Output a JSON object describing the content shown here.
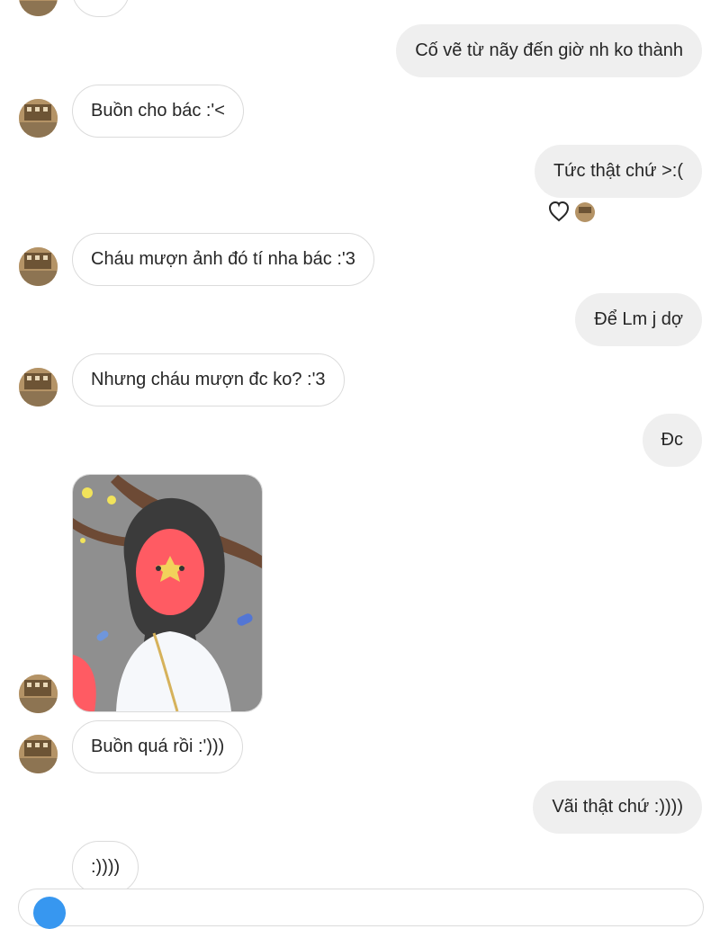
{
  "thread": {
    "messages": [
      {
        "side": "in",
        "text": ";;;;"
      },
      {
        "side": "out",
        "text": "Cố vẽ từ nãy đến giờ nh ko thành"
      },
      {
        "side": "in",
        "text": "Buồn cho bác :'<"
      },
      {
        "side": "out",
        "text": "Tức thật chứ >:("
      },
      {
        "side": "in",
        "text": "Cháu mượn ảnh đó tí nha bác :'3"
      },
      {
        "side": "out",
        "text": "Để Lm j dợ"
      },
      {
        "side": "in",
        "text": "Nhưng cháu mượn đc ko? :'3"
      },
      {
        "side": "out",
        "text": "Đc"
      },
      {
        "side": "in",
        "text": "Buồn quá rồi :')))"
      },
      {
        "side": "out",
        "text": "Vãi thật chứ :))))"
      },
      {
        "side": "in",
        "text": ":))))"
      }
    ],
    "reactions": {
      "icon": "heart-outline-icon"
    },
    "photo": {
      "icon": "shared-drawing-image"
    }
  },
  "colors": {
    "outgoing_bubble": "#efefef",
    "incoming_border": "#dbdbdb",
    "text": "#262626",
    "accent": "#3797f0"
  }
}
